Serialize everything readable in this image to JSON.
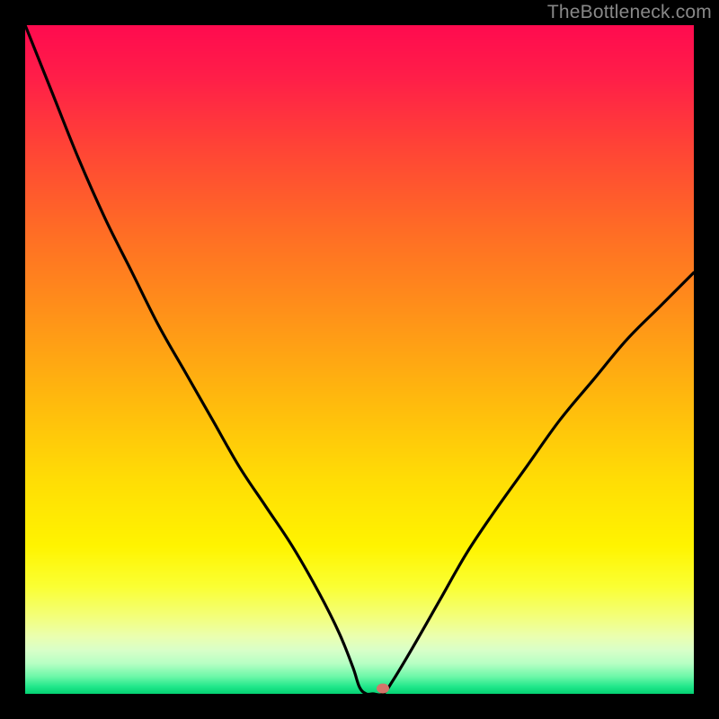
{
  "watermark": "TheBottleneck.com",
  "chart_data": {
    "type": "line",
    "title": "",
    "xlabel": "",
    "ylabel": "",
    "xlim": [
      0,
      100
    ],
    "ylim": [
      0,
      100
    ],
    "series": [
      {
        "name": "curve",
        "x": [
          0,
          4,
          8,
          12,
          16,
          20,
          24,
          28,
          32,
          36,
          40,
          44,
          47,
          49,
          50,
          51,
          52,
          53.5,
          55,
          58,
          62,
          66,
          70,
          75,
          80,
          85,
          90,
          95,
          100
        ],
        "y": [
          100,
          90,
          80,
          71,
          63,
          55,
          48,
          41,
          34,
          28,
          22,
          15,
          9,
          4,
          1,
          0,
          0,
          0,
          2,
          7,
          14,
          21,
          27,
          34,
          41,
          47,
          53,
          58,
          63
        ]
      }
    ],
    "marker": {
      "x": 53.5,
      "y": 0.8
    },
    "gradient_stops": [
      {
        "pos": 0.0,
        "color": "#ff0b4f"
      },
      {
        "pos": 0.08,
        "color": "#ff1f48"
      },
      {
        "pos": 0.18,
        "color": "#ff4336"
      },
      {
        "pos": 0.3,
        "color": "#ff6a26"
      },
      {
        "pos": 0.42,
        "color": "#ff8e1a"
      },
      {
        "pos": 0.55,
        "color": "#ffb60e"
      },
      {
        "pos": 0.68,
        "color": "#ffdd05"
      },
      {
        "pos": 0.78,
        "color": "#fff400"
      },
      {
        "pos": 0.84,
        "color": "#faff33"
      },
      {
        "pos": 0.885,
        "color": "#f3ff7a"
      },
      {
        "pos": 0.915,
        "color": "#eaffb0"
      },
      {
        "pos": 0.935,
        "color": "#d9ffc8"
      },
      {
        "pos": 0.955,
        "color": "#b7ffc4"
      },
      {
        "pos": 0.975,
        "color": "#6cf7a8"
      },
      {
        "pos": 0.99,
        "color": "#20e78a"
      },
      {
        "pos": 1.0,
        "color": "#06d374"
      }
    ]
  }
}
